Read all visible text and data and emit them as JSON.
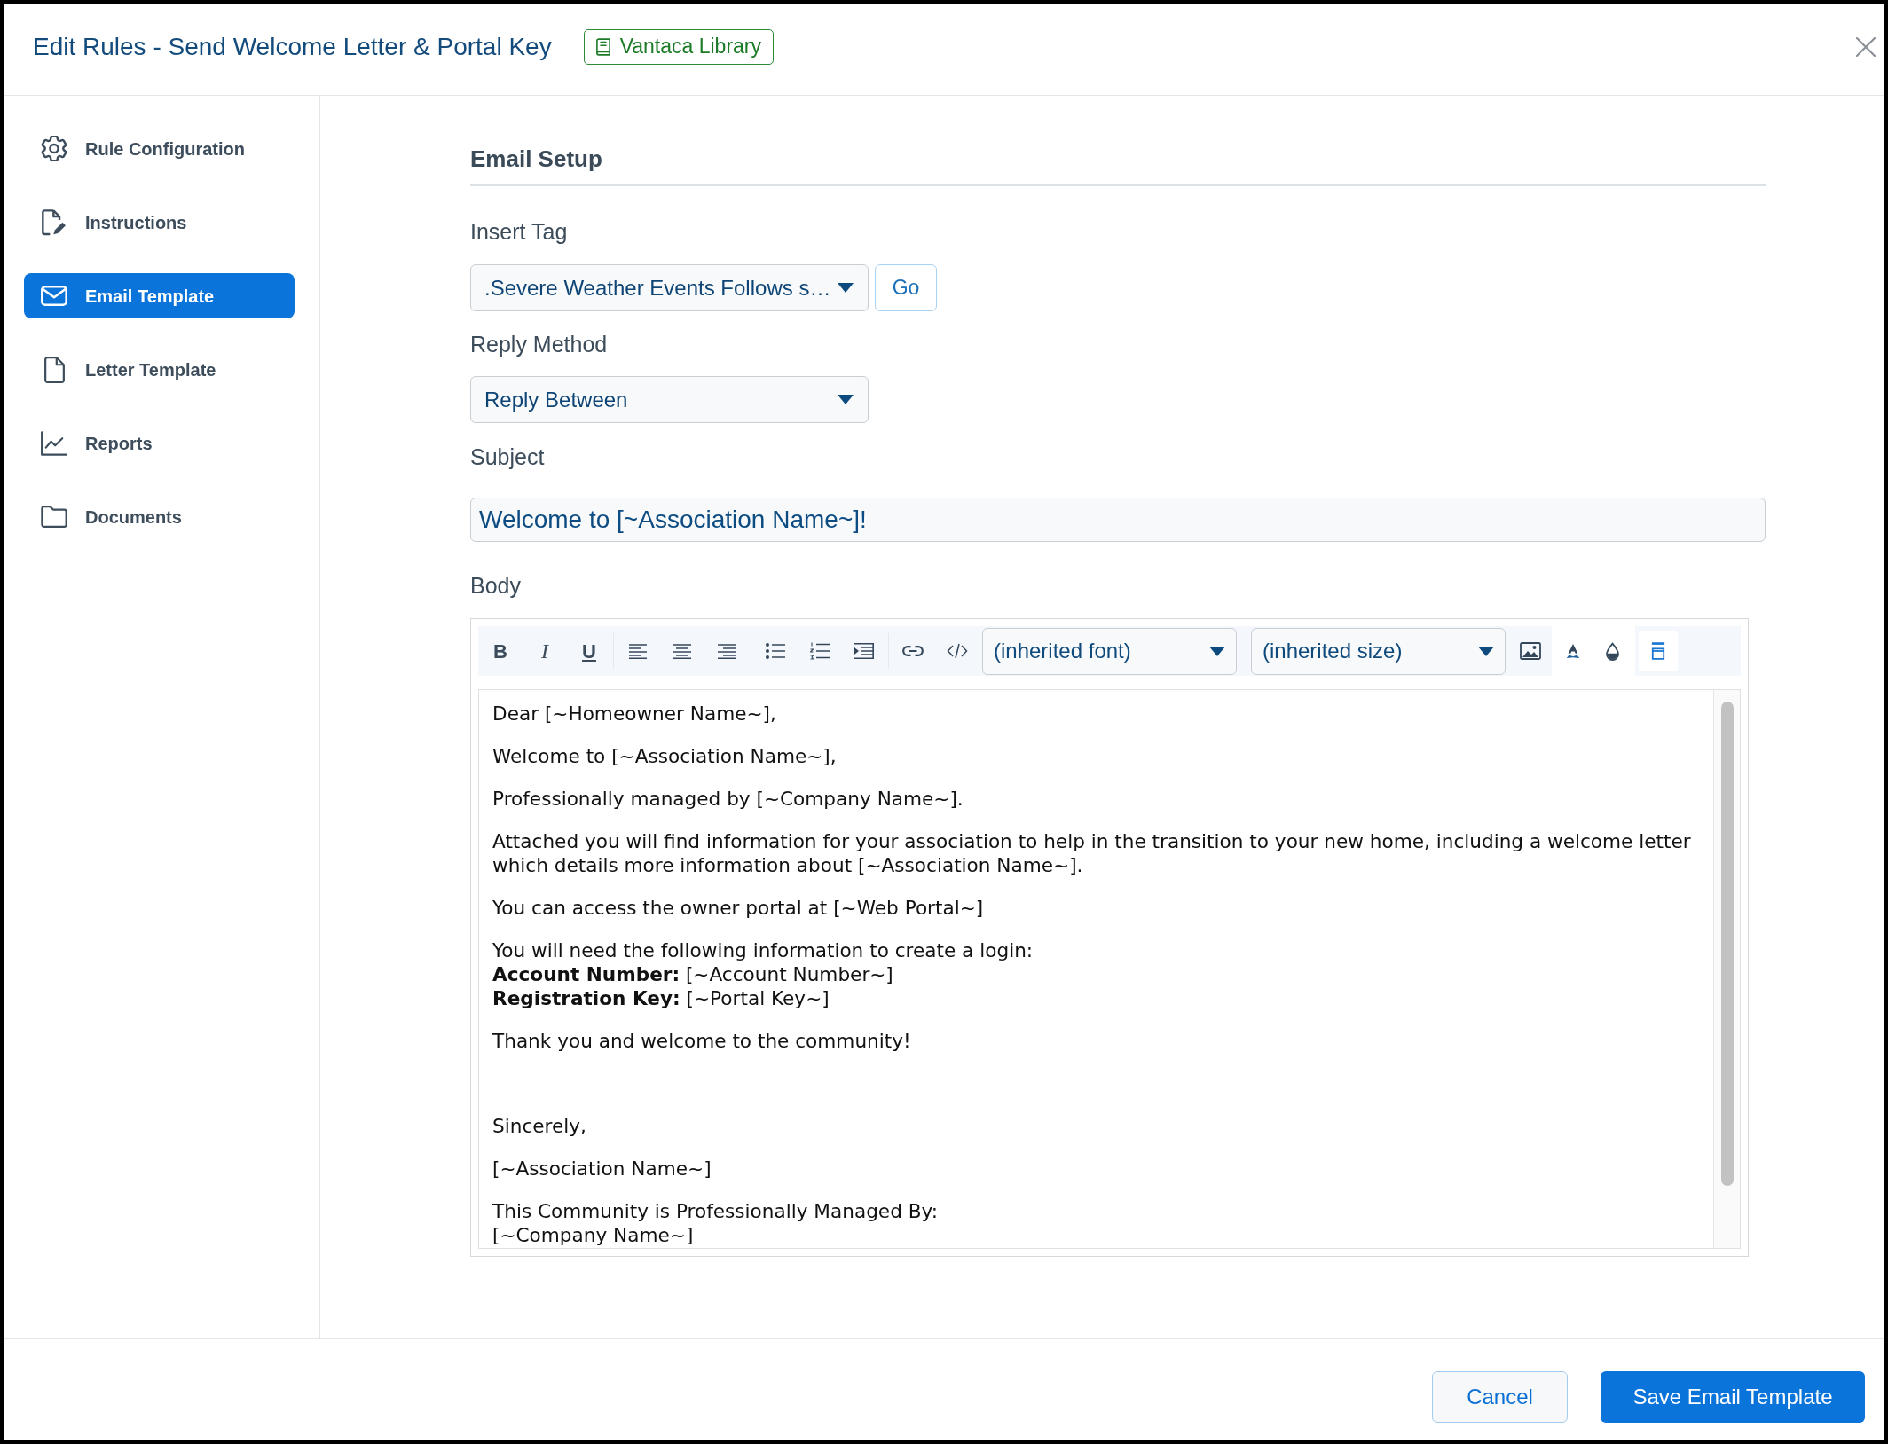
{
  "dialog": {
    "title": "Edit Rules - Send Welcome Letter & Portal Key",
    "badge": "Vantaca Library"
  },
  "sidebar": {
    "items": [
      {
        "label": "Rule Configuration",
        "selected": false
      },
      {
        "label": "Instructions",
        "selected": false
      },
      {
        "label": "Email Template",
        "selected": true
      },
      {
        "label": "Letter Template",
        "selected": false
      },
      {
        "label": "Reports",
        "selected": false
      },
      {
        "label": "Documents",
        "selected": false
      }
    ]
  },
  "section_title": "Email Setup",
  "insert_tag": {
    "label": "Insert Tag",
    "value": ".Severe Weather Events Follows s…",
    "button": "Go"
  },
  "reply_method": {
    "label": "Reply Method",
    "value": "Reply Between"
  },
  "subject": {
    "label": "Subject",
    "value": "Welcome to [~Association Name~]!"
  },
  "body": {
    "label": "Body",
    "toolbar": {
      "format_buttons": [
        "B",
        "I",
        "U"
      ],
      "font": "(inherited font)",
      "size": "(inherited size)",
      "end_button_active": true
    },
    "paragraphs": [
      {
        "kind": "text",
        "lines": [
          "Dear [~Homeowner Name~],"
        ]
      },
      {
        "kind": "text",
        "lines": [
          "Welcome to [~Association Name~],"
        ]
      },
      {
        "kind": "text",
        "lines": [
          "Professionally managed by [~Company Name~]."
        ]
      },
      {
        "kind": "text",
        "lines": [
          "Attached you will find information for your association to help in the transition to your new home, including a welcome letter which details more information about [~Association Name~]."
        ]
      },
      {
        "kind": "text",
        "lines": [
          "You can access the owner portal at [~Web Portal~]"
        ]
      },
      {
        "kind": "text",
        "lines": [
          "You will need the following information to create a login:",
          "**Account Number:** [~Account Number~]",
          "**Registration Key:** [~Portal Key~]"
        ]
      },
      {
        "kind": "text",
        "lines": [
          "Thank you and welcome to the community!"
        ]
      },
      {
        "kind": "blank"
      },
      {
        "kind": "text",
        "lines": [
          "Sincerely,"
        ]
      },
      {
        "kind": "text",
        "lines": [
          "[~Association Name~]"
        ]
      },
      {
        "kind": "text",
        "lines": [
          "This Community is Professionally Managed By:",
          "[~Company Name~]"
        ]
      }
    ]
  },
  "footer": {
    "buttons": [
      {
        "label": "Cancel",
        "kind": "secondary"
      },
      {
        "label": "Save Email Template",
        "kind": "primary"
      }
    ]
  }
}
